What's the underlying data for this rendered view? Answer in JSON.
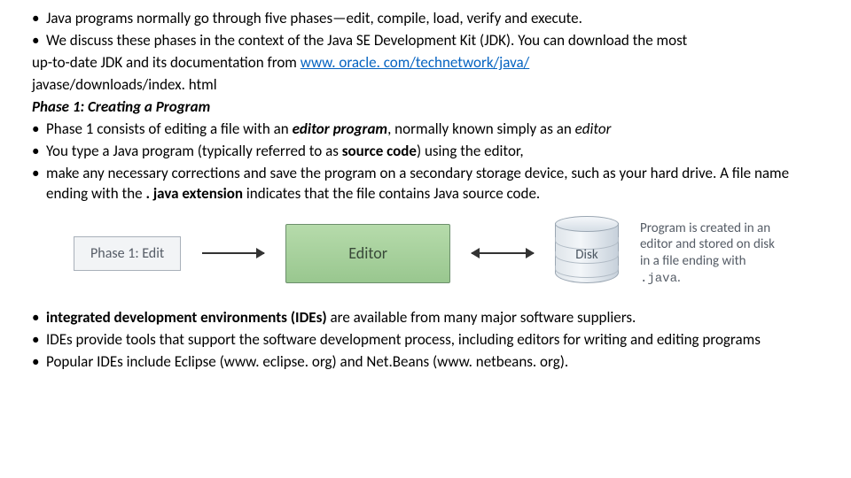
{
  "top": {
    "b1": "Java programs normally go through five phases—edit, compile, load, verify and execute.",
    "b2_a": "We discuss these phases in the context of the Java SE Development Kit (JDK). You can download the most",
    "b2_cont_a": "up-to-date JDK and its documentation from ",
    "b2_link": "www. oracle. com/technetwork/java/",
    "b2_cont_b": "javase/downloads/index. html"
  },
  "heading": "Phase 1: Creating a Program",
  "phase1": {
    "b1_a": "Phase 1 consists of editing a file with an ",
    "b1_em": "editor program",
    "b1_b": ", normally known simply as an ",
    "b1_em2": "editor",
    "b2_a": "You type a Java program (typically referred to as ",
    "b2_strong": "source code",
    "b2_b": ") using the editor,",
    "b3_a": "make any necessary corrections and save the program on a secondary storage device, such as your hard drive. A file name ending with the",
    "b3_strong": ". java extension",
    "b3_b": " indicates that the file contains Java source code."
  },
  "diagram": {
    "phase_label": "Phase 1: Edit",
    "editor_label": "Editor",
    "disk_label": "Disk",
    "caption_a": "Program is created in an editor and stored on disk in a file ending with ",
    "caption_code": ".java",
    "caption_b": "."
  },
  "bottom": {
    "b1_strong": "integrated development environments (IDEs)",
    "b1_rest": " are available from many major software suppliers.",
    "b2": "IDEs provide tools that support the software development process, including editors for writing and editing programs",
    "b3": "Popular IDEs include Eclipse (www. eclipse. org) and Net.Beans (www. netbeans. org)."
  }
}
